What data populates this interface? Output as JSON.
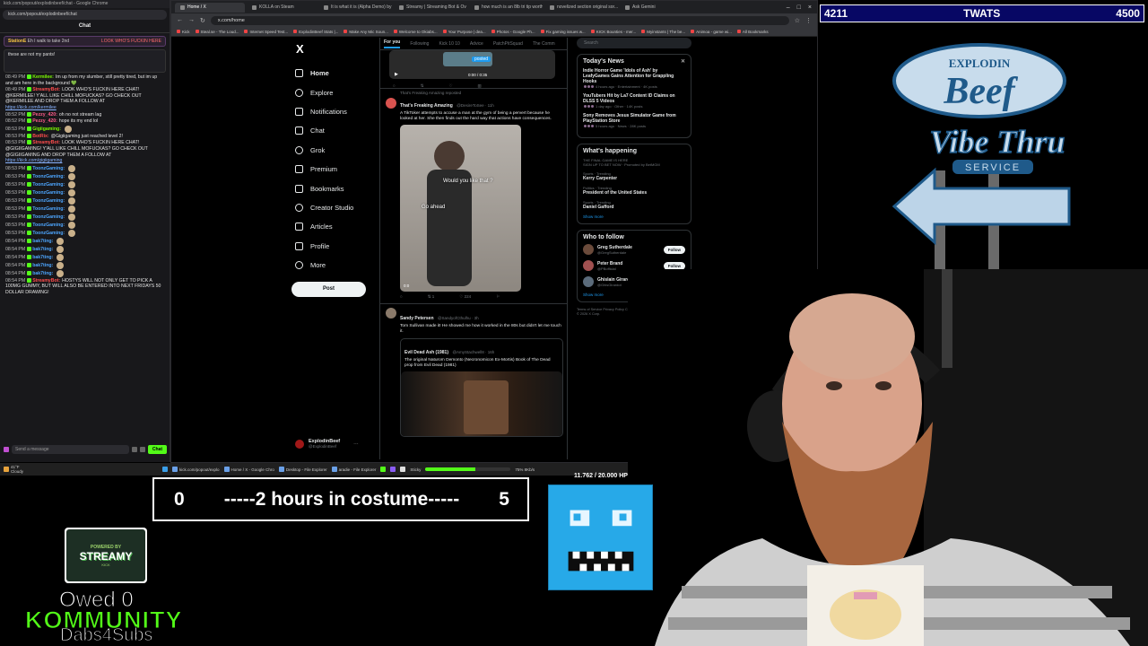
{
  "chat": {
    "window_title": "kick.com/popout/explodinbeef/chat - Google Chrome",
    "url": "kick.com/popout/explodinbeef/chat",
    "header": "Chat",
    "pinned_user": "StationE",
    "pinned_text": "Eh I walk to take 2nd",
    "notice_text": "LOOK WHO'S FUCKIN HERE",
    "shared_note": "these are not my pants!",
    "input_placeholder": "Send a message",
    "send_label": "Chat",
    "messages": [
      {
        "time": "08:49 PM",
        "user": "Kermilee",
        "color": "#7cfc00",
        "text": "Im up from my slumber, still pretty tired, but im up and am here in the background 💚"
      },
      {
        "time": "08:49 PM",
        "user": "StreamyBot",
        "color": "#ff4d4d",
        "text": "LOOK WHO'S FUCKIN HERE CHAT! @KERMILEE! Y'ALL LIKE CHILL MOFUCKAS? GO CHECK OUT @KERMILEE AND DROP THEM A FOLLOW AT",
        "link": "https://kick.com/kermilee"
      },
      {
        "time": "08:52 PM",
        "user": "Pezzy_420",
        "color": "#ff5c8a",
        "text": "oh no not stream lag"
      },
      {
        "time": "08:52 PM",
        "user": "Pezzy_420",
        "color": "#ff5c8a",
        "text": "hope its my end lol"
      },
      {
        "time": "08:53 PM",
        "user": "Gigiigaming",
        "color": "#7cfc00",
        "text": ""
      },
      {
        "time": "08:53 PM",
        "user": "BotRix",
        "color": "#ff4d4d",
        "text": "@Gigiigaming just reached level 2!"
      },
      {
        "time": "08:53 PM",
        "user": "StreamyBot",
        "color": "#ff4d4d",
        "text": "LOOK WHO'S FUCKIN HERE CHAT! @GIGIIGAMING! Y'ALL LIKE CHILL MOFUCKAS? GO CHECK OUT @GIGIIGAMING AND DROP THEM A FOLLOW AT",
        "link": "https://kick.com/gigiigaming"
      },
      {
        "time": "08:53 PM",
        "user": "ToonzGaming",
        "color": "#4da6ff",
        "text": ""
      },
      {
        "time": "08:53 PM",
        "user": "ToonzGaming",
        "color": "#4da6ff",
        "text": ""
      },
      {
        "time": "08:53 PM",
        "user": "ToonzGaming",
        "color": "#4da6ff",
        "text": ""
      },
      {
        "time": "08:53 PM",
        "user": "ToonzGaming",
        "color": "#4da6ff",
        "text": ""
      },
      {
        "time": "08:53 PM",
        "user": "ToonzGaming",
        "color": "#4da6ff",
        "text": ""
      },
      {
        "time": "08:53 PM",
        "user": "ToonzGaming",
        "color": "#4da6ff",
        "text": ""
      },
      {
        "time": "08:53 PM",
        "user": "ToonzGaming",
        "color": "#4da6ff",
        "text": ""
      },
      {
        "time": "08:53 PM",
        "user": "ToonzGaming",
        "color": "#4da6ff",
        "text": ""
      },
      {
        "time": "08:53 PM",
        "user": "ToonzGaming",
        "color": "#4da6ff",
        "text": ""
      },
      {
        "time": "08:54 PM",
        "user": "bak7ting",
        "color": "#4da6ff",
        "text": ""
      },
      {
        "time": "08:54 PM",
        "user": "bak7ting",
        "color": "#4da6ff",
        "text": ""
      },
      {
        "time": "08:54 PM",
        "user": "bak7ting",
        "color": "#4da6ff",
        "text": ""
      },
      {
        "time": "08:54 PM",
        "user": "bak7ting",
        "color": "#4da6ff",
        "text": ""
      },
      {
        "time": "08:54 PM",
        "user": "bak7ting",
        "color": "#4da6ff",
        "text": ""
      },
      {
        "time": "08:54 PM",
        "user": "StreamyBot",
        "color": "#ff4d4d",
        "text": "HOSTYS WILL NOT ONLY GET TO PICK A 100MG GUMMY, BUT WILL ALSO BE ENTERED INTO NEXT FRIDAYS 50 DOLLAR DRAWING!"
      }
    ]
  },
  "browser": {
    "tabs": [
      {
        "label": "Home / X",
        "active": true
      },
      {
        "label": "KOLLA on Steam",
        "active": false
      },
      {
        "label": "It is what it is (Alpha Demo) by",
        "active": false
      },
      {
        "label": "Streamy | Streaming Bot & Ov",
        "active": false
      },
      {
        "label": "how much is an 8lb tri tip worth",
        "active": false
      },
      {
        "label": "novelized section original sor...",
        "active": false
      },
      {
        "label": "Ask Gemini",
        "active": false
      }
    ],
    "url": "x.com/home",
    "bookmarks": [
      "Kick",
      "Steal.se - The Loud...",
      "Internet Speed Test...",
      "ExplodinBeef Stats |...",
      "Make Any Mic Soun...",
      "Welcome to Okiabs...",
      "Your Purpose | dea...",
      "Photos - Google Ph...",
      "Fix gaming issues w...",
      "KICK Bounties - mer...",
      "Myinstants | The be...",
      "Animoa - game wi...",
      "All Bookmarks"
    ]
  },
  "x": {
    "logo": "X",
    "nav": [
      "Home",
      "Explore",
      "Notifications",
      "Chat",
      "Grok",
      "Premium",
      "Bookmarks",
      "Creator Studio",
      "Articles",
      "Profile",
      "More"
    ],
    "post_button": "Post",
    "profile_name": "ExplodinBeef",
    "profile_handle": "@ExplodinBeef",
    "feed_tabs": [
      "For you",
      "Following",
      "Kick 10 10",
      "Advice",
      "PatchPitSquad",
      "The Comm"
    ],
    "video1_time": "0:00 / 0:35",
    "video1_overlay": "posted",
    "tweet1": {
      "context": "That's Freaking Amazing reposted",
      "name": "That's Freaking Amazing",
      "handle": "@DesireToSee · 11h",
      "text": "A TikToker attempts to accuse a man at the gym of being a pervert because he looked at her. She then finds out the hard way that actions have consequences.",
      "caption1": "Would you like that ?",
      "caption2": "Go ahead",
      "duration": "0:0",
      "stats": [
        "1",
        "",
        "224",
        ""
      ]
    },
    "tweet2": {
      "name": "Sandy Petersen",
      "handle": "@SandyofCthulhu · 3h",
      "text": "Tom Sullivan made it! He showed me how it worked in the 80s but didn't let me touch it.",
      "quote_name": "Evil Dead Ash (1981)",
      "quote_handle": "@AmyStachwell8 · 16h",
      "quote_text": "The original Naturom Demonto (Necronomicon Ex-Mortis) Book of The Dead prop from Evil Dead (1981)"
    },
    "search_placeholder": "Search",
    "news_title": "Today's News",
    "news": [
      {
        "title": "Indie Horror Game 'Idols of Ash' by LeafyGames Gains Attention for Grappling Hooks",
        "meta": "4 hours ago · Entertainment · 4K posts"
      },
      {
        "title": "YouTubers Hit by La7 Content ID Claims on DLSS 5 Videos",
        "meta": "1 day ago · Other · 14K posts"
      },
      {
        "title": "Sony Removes Jesus Simulator Game from PlayStation Store",
        "meta": "5 hours ago · News · 28K posts"
      }
    ],
    "happening_title": "What's happening",
    "trends": [
      {
        "ctx": "THE FINAL GAME IS HERE",
        "name": "",
        "sub": "SIGN UP TO BET NOW · Promoted by BetMGM"
      },
      {
        "ctx": "Sports · Trending",
        "name": "Kerry Carpenter",
        "sub": ""
      },
      {
        "ctx": "Politics · Trending",
        "name": "President of the United States",
        "sub": ""
      },
      {
        "ctx": "Sports · Trending",
        "name": "Daniel Gafford",
        "sub": ""
      }
    ],
    "show_more": "Show more",
    "wtf_title": "Who to follow",
    "follow": [
      {
        "name": "Greg Sutherdale",
        "handle": "@GregSutherdale",
        "btn": "Follow"
      },
      {
        "name": "Peter Brand",
        "handle": "@PBofficial",
        "btn": "Follow"
      },
      {
        "name": "Ghislain Girardot",
        "handle": "@GhisGirardot",
        "btn": "Follow"
      }
    ],
    "footer": "Terms of Service  Privacy Policy  Cookie Policy  Accessibility  Ads info  More ...  © 2026 X Corp."
  },
  "taskbar": {
    "items": [
      "kick.com/popout/explo",
      "Home / X - Google Chro",
      "Desktop - File Explorer",
      "aradie - File Explorer"
    ],
    "weather": "41°F",
    "weather_sub": "Cloudy",
    "sticky": "Sticky",
    "health": "75% 8Kb/s",
    "clock": "8:54 PM",
    "date": "4/3/2026"
  },
  "overlay": {
    "goal_left": "4211",
    "goal_title": "TWATS",
    "goal_right": "4500",
    "logo_line1": "EXPLODIN",
    "logo_line2": "Beef",
    "logo_line3": "Vibe Thru",
    "logo_line4": "SERVICE",
    "hp_text": "11.762 / 20.000 HP",
    "hp_fraction": 0.588,
    "costume_left": "0",
    "costume_text": "-----2 hours in costume-----",
    "costume_right": "5",
    "streamy_powered": "POWERED BY",
    "streamy_name": "STREAMY",
    "streamy_site": "KICK",
    "owed": "Owed 0",
    "kommunity": "KOMMUNITY",
    "dabs": "Dabs4Subs"
  },
  "colors": {
    "kick_green": "#53fc18",
    "x_blue": "#1d9bf0",
    "goal_bg": "#070764",
    "monster_blue": "#27a9e8"
  }
}
